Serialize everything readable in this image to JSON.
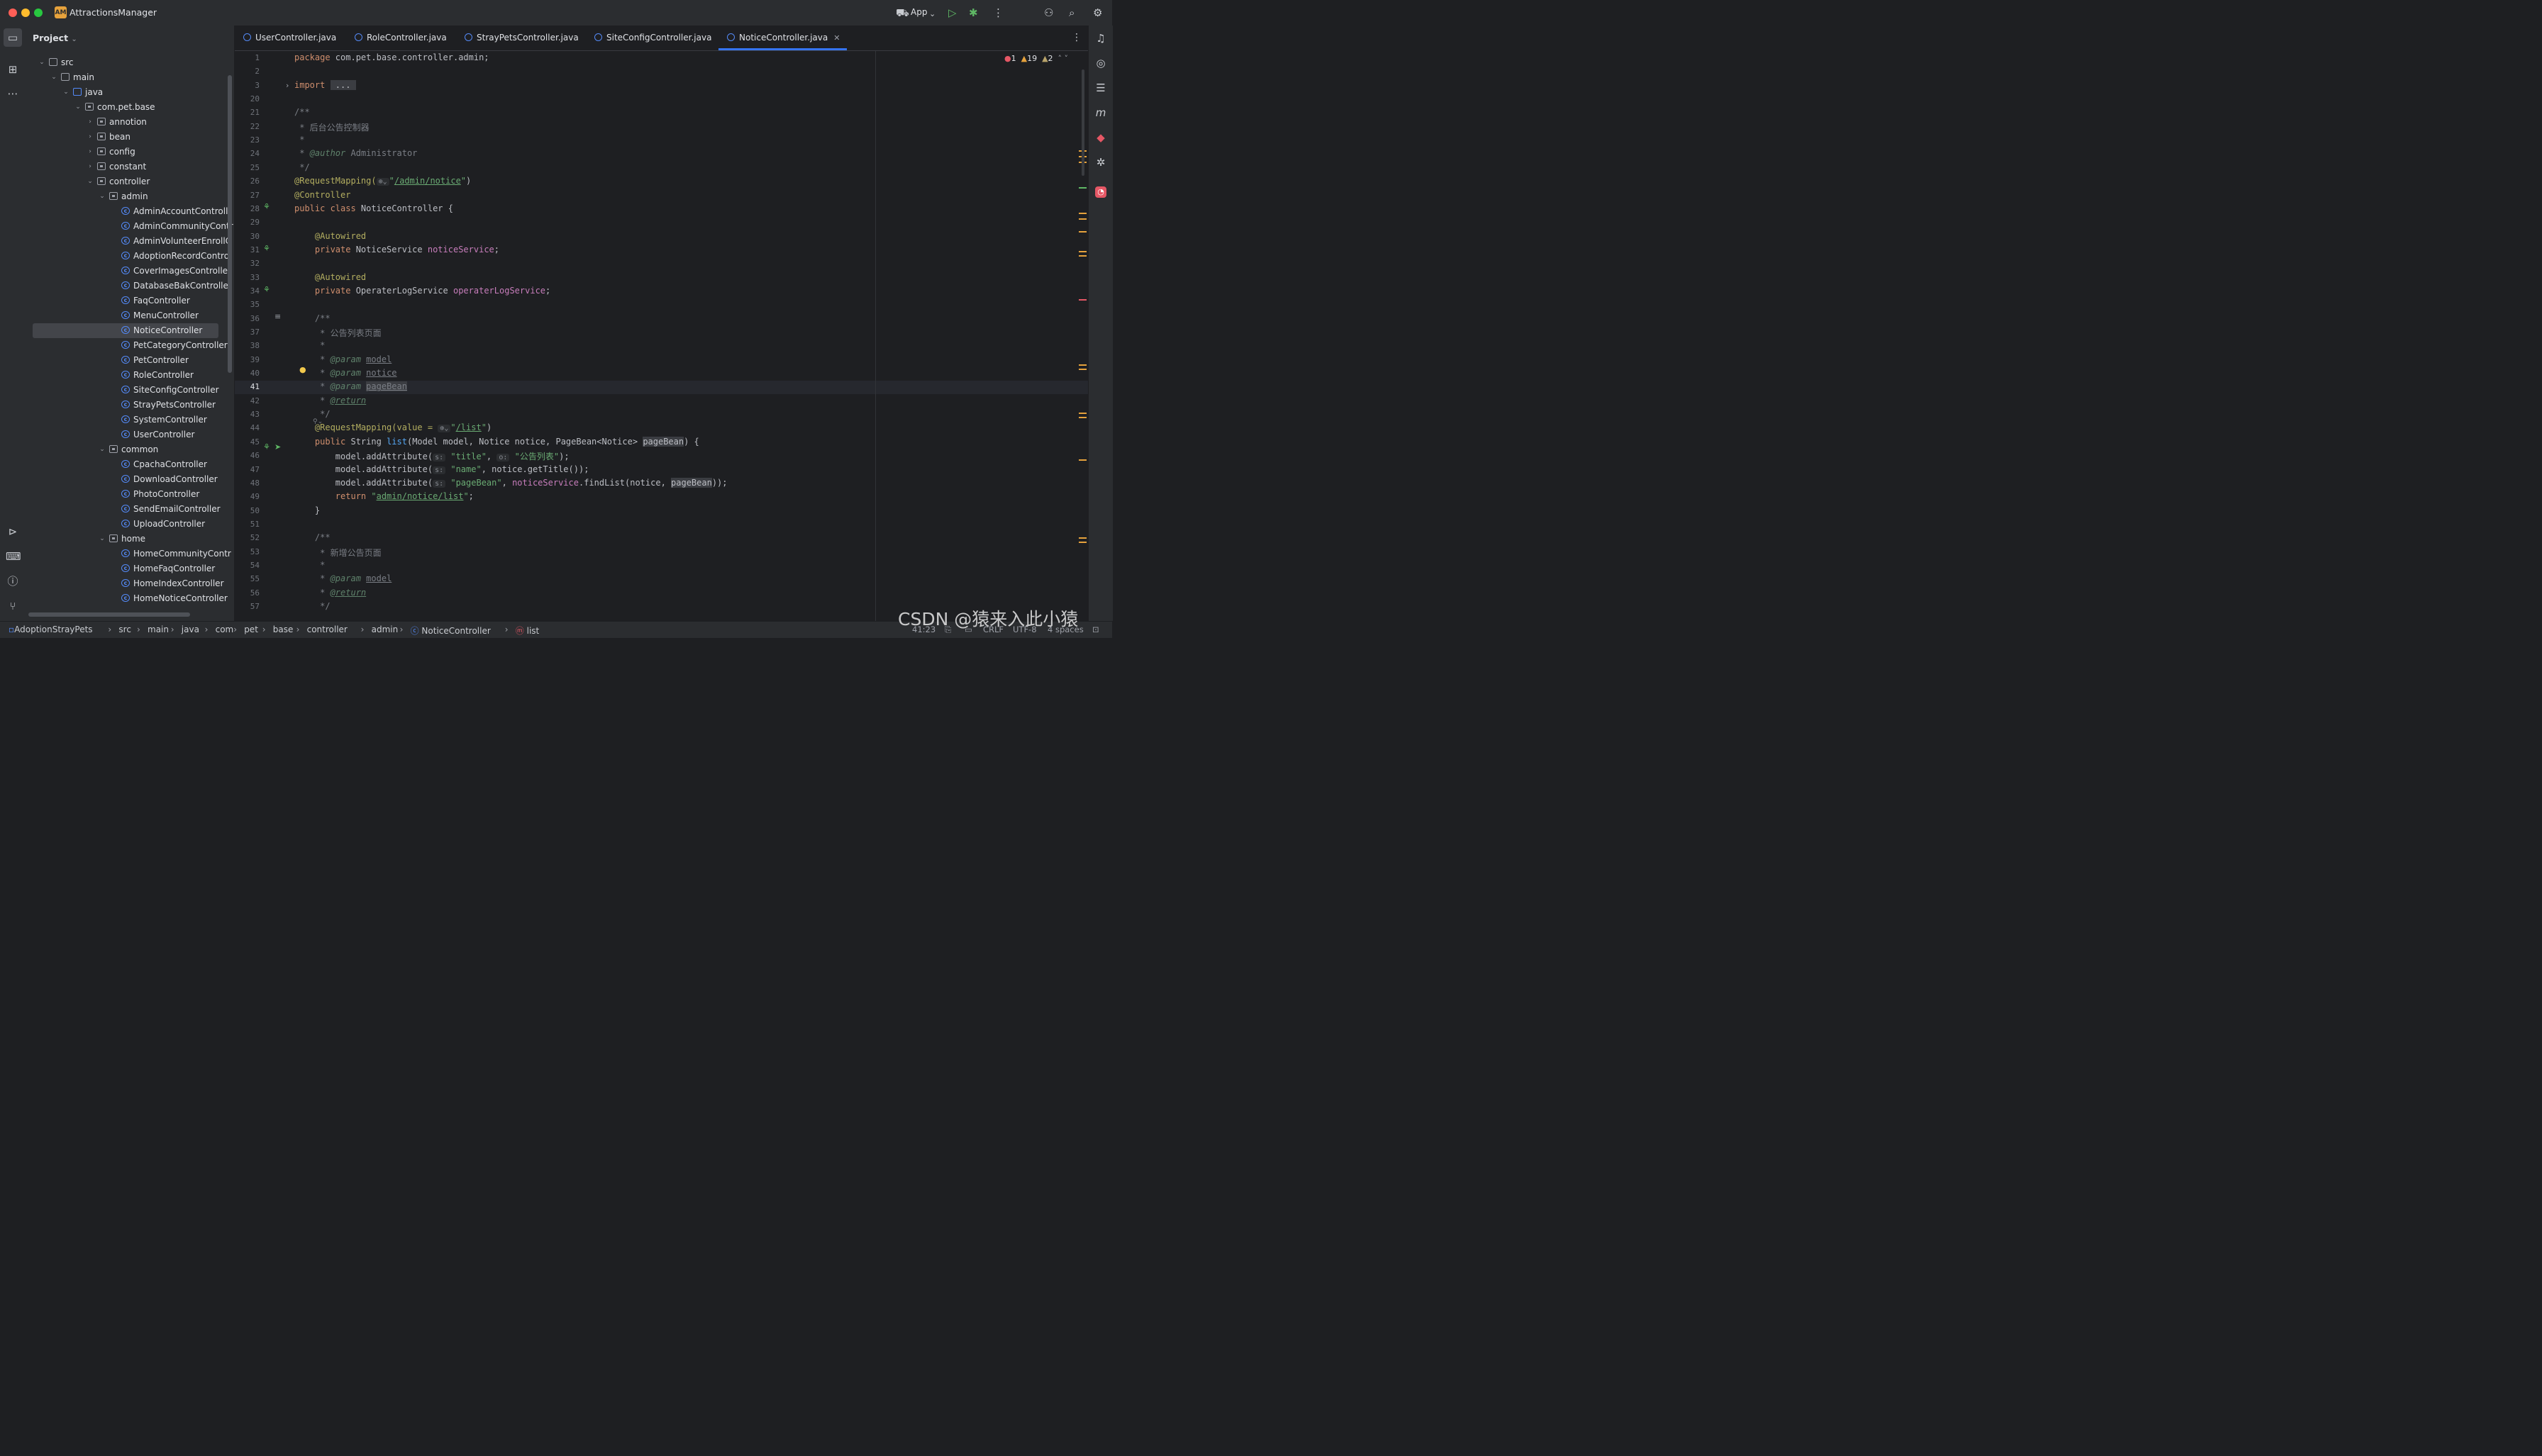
{
  "window": {
    "project_badge": "AM",
    "project_name": "AttractionsManager",
    "run_config": "App"
  },
  "project_panel": {
    "title": "Project",
    "tree": [
      {
        "label": "src",
        "indent": 1,
        "kind": "folder",
        "expanded": true
      },
      {
        "label": "main",
        "indent": 2,
        "kind": "folder",
        "expanded": true
      },
      {
        "label": "java",
        "indent": 3,
        "kind": "folder-blue",
        "expanded": true
      },
      {
        "label": "com.pet.base",
        "indent": 4,
        "kind": "pkg",
        "expanded": true
      },
      {
        "label": "annotion",
        "indent": 5,
        "kind": "pkg",
        "expanded": false
      },
      {
        "label": "bean",
        "indent": 5,
        "kind": "pkg",
        "expanded": false
      },
      {
        "label": "config",
        "indent": 5,
        "kind": "pkg",
        "expanded": false
      },
      {
        "label": "constant",
        "indent": 5,
        "kind": "pkg",
        "expanded": false
      },
      {
        "label": "controller",
        "indent": 5,
        "kind": "pkg",
        "expanded": true
      },
      {
        "label": "admin",
        "indent": 6,
        "kind": "pkg",
        "expanded": true
      },
      {
        "label": "AdminAccountControll",
        "indent": 7,
        "kind": "class"
      },
      {
        "label": "AdminCommunityContr",
        "indent": 7,
        "kind": "class"
      },
      {
        "label": "AdminVolunteerEnrollC",
        "indent": 7,
        "kind": "class"
      },
      {
        "label": "AdoptionRecordContro",
        "indent": 7,
        "kind": "class"
      },
      {
        "label": "CoverImagesController",
        "indent": 7,
        "kind": "class"
      },
      {
        "label": "DatabaseBakController",
        "indent": 7,
        "kind": "class"
      },
      {
        "label": "FaqController",
        "indent": 7,
        "kind": "class"
      },
      {
        "label": "MenuController",
        "indent": 7,
        "kind": "class"
      },
      {
        "label": "NoticeController",
        "indent": 7,
        "kind": "class",
        "selected": true
      },
      {
        "label": "PetCategoryController",
        "indent": 7,
        "kind": "class"
      },
      {
        "label": "PetController",
        "indent": 7,
        "kind": "class"
      },
      {
        "label": "RoleController",
        "indent": 7,
        "kind": "class"
      },
      {
        "label": "SiteConfigController",
        "indent": 7,
        "kind": "class"
      },
      {
        "label": "StrayPetsController",
        "indent": 7,
        "kind": "class"
      },
      {
        "label": "SystemController",
        "indent": 7,
        "kind": "class"
      },
      {
        "label": "UserController",
        "indent": 7,
        "kind": "class"
      },
      {
        "label": "common",
        "indent": 6,
        "kind": "pkg",
        "expanded": true
      },
      {
        "label": "CpachaController",
        "indent": 7,
        "kind": "class"
      },
      {
        "label": "DownloadController",
        "indent": 7,
        "kind": "class"
      },
      {
        "label": "PhotoController",
        "indent": 7,
        "kind": "class"
      },
      {
        "label": "SendEmailController",
        "indent": 7,
        "kind": "class"
      },
      {
        "label": "UploadController",
        "indent": 7,
        "kind": "class"
      },
      {
        "label": "home",
        "indent": 6,
        "kind": "pkg",
        "expanded": true
      },
      {
        "label": "HomeCommunityContr",
        "indent": 7,
        "kind": "class"
      },
      {
        "label": "HomeFaqController",
        "indent": 7,
        "kind": "class"
      },
      {
        "label": "HomeIndexController",
        "indent": 7,
        "kind": "class"
      },
      {
        "label": "HomeNoticeController",
        "indent": 7,
        "kind": "class"
      }
    ]
  },
  "tabs": [
    {
      "label": "UserController.java",
      "active": false
    },
    {
      "label": "RoleController.java",
      "active": false
    },
    {
      "label": "StrayPetsController.java",
      "active": false
    },
    {
      "label": "SiteConfigController.java",
      "active": false
    },
    {
      "label": "NoticeController.java",
      "active": true
    }
  ],
  "inspections": {
    "errors": "1",
    "warnings": "19",
    "weak_warnings": "2"
  },
  "current_line": 41,
  "code": [
    {
      "n": 1,
      "parts": [
        [
          "kw",
          "package "
        ],
        [
          "",
          "com.pet.base.controller.admin;"
        ]
      ]
    },
    {
      "n": 2,
      "parts": []
    },
    {
      "n": 3,
      "parts": [
        [
          "kw",
          "import "
        ],
        [
          "hl",
          " ... "
        ]
      ],
      "fold": true
    },
    {
      "n": 20,
      "parts": []
    },
    {
      "n": 21,
      "parts": [
        [
          "cm",
          "/**"
        ]
      ]
    },
    {
      "n": 22,
      "parts": [
        [
          "cm",
          " * 后台公告控制器"
        ]
      ]
    },
    {
      "n": 23,
      "parts": [
        [
          "cm",
          " *"
        ]
      ]
    },
    {
      "n": 24,
      "parts": [
        [
          "cm",
          " * "
        ],
        [
          "dtag",
          "@author"
        ],
        [
          "cm",
          " Administrator"
        ]
      ]
    },
    {
      "n": 25,
      "parts": [
        [
          "cm",
          " */"
        ]
      ]
    },
    {
      "n": 26,
      "parts": [
        [
          "an",
          "@RequestMapping("
        ],
        [
          "hint",
          "⊕⌄"
        ],
        [
          "str",
          "\""
        ],
        [
          "str ul",
          "/admin/notice"
        ],
        [
          "str",
          "\""
        ],
        [
          "",
          ")"
        ]
      ]
    },
    {
      "n": 27,
      "parts": [
        [
          "an",
          "@Controller"
        ]
      ]
    },
    {
      "n": 28,
      "parts": [
        [
          "kw",
          "public class "
        ],
        [
          "",
          "NoticeController {"
        ]
      ]
    },
    {
      "n": 29,
      "parts": []
    },
    {
      "n": 30,
      "parts": [
        [
          "",
          "    "
        ],
        [
          "an",
          "@Autowired"
        ]
      ]
    },
    {
      "n": 31,
      "parts": [
        [
          "kw",
          "    private "
        ],
        [
          "",
          "NoticeService "
        ],
        [
          "fld",
          "noticeService"
        ],
        [
          "",
          ";"
        ]
      ]
    },
    {
      "n": 32,
      "parts": []
    },
    {
      "n": 33,
      "parts": [
        [
          "",
          "    "
        ],
        [
          "an",
          "@Autowired"
        ]
      ]
    },
    {
      "n": 34,
      "parts": [
        [
          "kw",
          "    private "
        ],
        [
          "",
          "OperaterLogService "
        ],
        [
          "fld",
          "operaterLogService"
        ],
        [
          "",
          ";"
        ]
      ]
    },
    {
      "n": 35,
      "parts": []
    },
    {
      "n": 36,
      "parts": [
        [
          "cm",
          "    /**"
        ]
      ]
    },
    {
      "n": 37,
      "parts": [
        [
          "cm",
          "     * 公告列表页面"
        ]
      ]
    },
    {
      "n": 38,
      "parts": [
        [
          "cm",
          "     *"
        ]
      ]
    },
    {
      "n": 39,
      "parts": [
        [
          "cm",
          "     * "
        ],
        [
          "dtag",
          "@param"
        ],
        [
          "cm",
          " "
        ],
        [
          "cm ul",
          "model"
        ]
      ]
    },
    {
      "n": 40,
      "parts": [
        [
          "cm",
          "     * "
        ],
        [
          "dtag",
          "@param"
        ],
        [
          "cm",
          " "
        ],
        [
          "cm ul",
          "notice"
        ]
      ]
    },
    {
      "n": 41,
      "parts": [
        [
          "cm",
          "     * "
        ],
        [
          "dtag",
          "@param"
        ],
        [
          "cm",
          " "
        ],
        [
          "cm ul hl",
          "pageBean"
        ]
      ]
    },
    {
      "n": 42,
      "parts": [
        [
          "cm",
          "     * "
        ],
        [
          "dtag ul",
          "@return"
        ]
      ]
    },
    {
      "n": 43,
      "parts": [
        [
          "cm",
          "     */"
        ]
      ]
    },
    {
      "n": 44,
      "parts": [
        [
          "",
          "    "
        ],
        [
          "an",
          "@RequestMapping(value = "
        ],
        [
          "hint",
          "⊕⌄"
        ],
        [
          "str",
          "\""
        ],
        [
          "str ul",
          "/list"
        ],
        [
          "str",
          "\""
        ],
        [
          "",
          ")"
        ]
      ]
    },
    {
      "n": 45,
      "parts": [
        [
          "kw",
          "    public "
        ],
        [
          "",
          "String "
        ],
        [
          "fn",
          "list"
        ],
        [
          "",
          "(Model model, Notice notice, PageBean<Notice> "
        ],
        [
          "hl",
          "pageBean"
        ],
        [
          "",
          ") {"
        ]
      ]
    },
    {
      "n": 46,
      "parts": [
        [
          "",
          "        model.addAttribute("
        ],
        [
          "hint",
          "s:"
        ],
        [
          "str",
          " \"title\""
        ],
        [
          "",
          ", "
        ],
        [
          "hint",
          "o:"
        ],
        [
          "str",
          " \"公告列表\""
        ],
        [
          "",
          ");"
        ]
      ]
    },
    {
      "n": 47,
      "parts": [
        [
          "",
          "        model.addAttribute("
        ],
        [
          "hint",
          "s:"
        ],
        [
          "str",
          " \"name\""
        ],
        [
          "",
          ", notice.getTitle());"
        ]
      ]
    },
    {
      "n": 48,
      "parts": [
        [
          "",
          "        model.addAttribute("
        ],
        [
          "hint",
          "s:"
        ],
        [
          "str",
          " \"pageBean\""
        ],
        [
          "",
          ", "
        ],
        [
          "fld",
          "noticeService"
        ],
        [
          "",
          ".findList(notice, "
        ],
        [
          "hl",
          "pageBean"
        ],
        [
          "",
          "));"
        ]
      ]
    },
    {
      "n": 49,
      "parts": [
        [
          "kw",
          "        return "
        ],
        [
          "str",
          "\""
        ],
        [
          "str ul",
          "admin/notice/list"
        ],
        [
          "str",
          "\""
        ],
        [
          "",
          ";"
        ]
      ]
    },
    {
      "n": 50,
      "parts": [
        [
          "",
          "    }"
        ]
      ]
    },
    {
      "n": 51,
      "parts": []
    },
    {
      "n": 52,
      "parts": [
        [
          "cm",
          "    /**"
        ]
      ]
    },
    {
      "n": 53,
      "parts": [
        [
          "cm",
          "     * 新增公告页面"
        ]
      ]
    },
    {
      "n": 54,
      "parts": [
        [
          "cm",
          "     *"
        ]
      ]
    },
    {
      "n": 55,
      "parts": [
        [
          "cm",
          "     * "
        ],
        [
          "dtag",
          "@param"
        ],
        [
          "cm",
          " "
        ],
        [
          "cm ul",
          "model"
        ]
      ]
    },
    {
      "n": 56,
      "parts": [
        [
          "cm",
          "     * "
        ],
        [
          "dtag ul",
          "@return"
        ]
      ]
    },
    {
      "n": 57,
      "parts": [
        [
          "cm",
          "     */"
        ]
      ]
    }
  ],
  "breadcrumbs": [
    "AdoptionStrayPets",
    "src",
    "main",
    "java",
    "com",
    "pet",
    "base",
    "controller",
    "admin",
    "NoticeController",
    "list"
  ],
  "status": {
    "position": "41:23",
    "line_sep": "CRLF",
    "encoding": "UTF-8",
    "indent": "4 spaces"
  },
  "watermark": "CSDN @猿来入此小猿",
  "colors": {
    "accent": "#3574f0",
    "background": "#1e1f22",
    "panel": "#2b2d30",
    "error": "#e55765",
    "warning": "#e6a23c"
  }
}
